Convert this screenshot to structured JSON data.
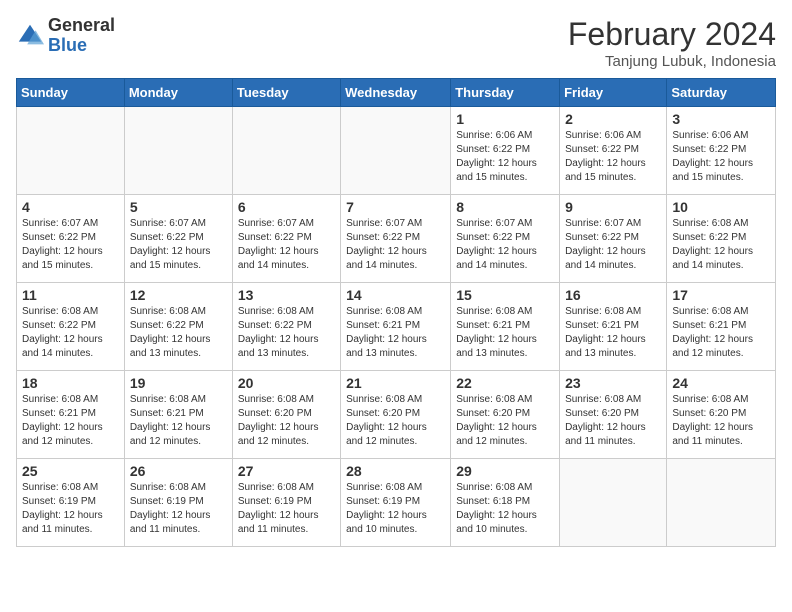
{
  "logo": {
    "general": "General",
    "blue": "Blue"
  },
  "title": {
    "month_year": "February 2024",
    "location": "Tanjung Lubuk, Indonesia"
  },
  "days_of_week": [
    "Sunday",
    "Monday",
    "Tuesday",
    "Wednesday",
    "Thursday",
    "Friday",
    "Saturday"
  ],
  "weeks": [
    [
      {
        "day": "",
        "info": ""
      },
      {
        "day": "",
        "info": ""
      },
      {
        "day": "",
        "info": ""
      },
      {
        "day": "",
        "info": ""
      },
      {
        "day": "1",
        "info": "Sunrise: 6:06 AM\nSunset: 6:22 PM\nDaylight: 12 hours and 15 minutes."
      },
      {
        "day": "2",
        "info": "Sunrise: 6:06 AM\nSunset: 6:22 PM\nDaylight: 12 hours and 15 minutes."
      },
      {
        "day": "3",
        "info": "Sunrise: 6:06 AM\nSunset: 6:22 PM\nDaylight: 12 hours and 15 minutes."
      }
    ],
    [
      {
        "day": "4",
        "info": "Sunrise: 6:07 AM\nSunset: 6:22 PM\nDaylight: 12 hours and 15 minutes."
      },
      {
        "day": "5",
        "info": "Sunrise: 6:07 AM\nSunset: 6:22 PM\nDaylight: 12 hours and 15 minutes."
      },
      {
        "day": "6",
        "info": "Sunrise: 6:07 AM\nSunset: 6:22 PM\nDaylight: 12 hours and 14 minutes."
      },
      {
        "day": "7",
        "info": "Sunrise: 6:07 AM\nSunset: 6:22 PM\nDaylight: 12 hours and 14 minutes."
      },
      {
        "day": "8",
        "info": "Sunrise: 6:07 AM\nSunset: 6:22 PM\nDaylight: 12 hours and 14 minutes."
      },
      {
        "day": "9",
        "info": "Sunrise: 6:07 AM\nSunset: 6:22 PM\nDaylight: 12 hours and 14 minutes."
      },
      {
        "day": "10",
        "info": "Sunrise: 6:08 AM\nSunset: 6:22 PM\nDaylight: 12 hours and 14 minutes."
      }
    ],
    [
      {
        "day": "11",
        "info": "Sunrise: 6:08 AM\nSunset: 6:22 PM\nDaylight: 12 hours and 14 minutes."
      },
      {
        "day": "12",
        "info": "Sunrise: 6:08 AM\nSunset: 6:22 PM\nDaylight: 12 hours and 13 minutes."
      },
      {
        "day": "13",
        "info": "Sunrise: 6:08 AM\nSunset: 6:22 PM\nDaylight: 12 hours and 13 minutes."
      },
      {
        "day": "14",
        "info": "Sunrise: 6:08 AM\nSunset: 6:21 PM\nDaylight: 12 hours and 13 minutes."
      },
      {
        "day": "15",
        "info": "Sunrise: 6:08 AM\nSunset: 6:21 PM\nDaylight: 12 hours and 13 minutes."
      },
      {
        "day": "16",
        "info": "Sunrise: 6:08 AM\nSunset: 6:21 PM\nDaylight: 12 hours and 13 minutes."
      },
      {
        "day": "17",
        "info": "Sunrise: 6:08 AM\nSunset: 6:21 PM\nDaylight: 12 hours and 12 minutes."
      }
    ],
    [
      {
        "day": "18",
        "info": "Sunrise: 6:08 AM\nSunset: 6:21 PM\nDaylight: 12 hours and 12 minutes."
      },
      {
        "day": "19",
        "info": "Sunrise: 6:08 AM\nSunset: 6:21 PM\nDaylight: 12 hours and 12 minutes."
      },
      {
        "day": "20",
        "info": "Sunrise: 6:08 AM\nSunset: 6:20 PM\nDaylight: 12 hours and 12 minutes."
      },
      {
        "day": "21",
        "info": "Sunrise: 6:08 AM\nSunset: 6:20 PM\nDaylight: 12 hours and 12 minutes."
      },
      {
        "day": "22",
        "info": "Sunrise: 6:08 AM\nSunset: 6:20 PM\nDaylight: 12 hours and 12 minutes."
      },
      {
        "day": "23",
        "info": "Sunrise: 6:08 AM\nSunset: 6:20 PM\nDaylight: 12 hours and 11 minutes."
      },
      {
        "day": "24",
        "info": "Sunrise: 6:08 AM\nSunset: 6:20 PM\nDaylight: 12 hours and 11 minutes."
      }
    ],
    [
      {
        "day": "25",
        "info": "Sunrise: 6:08 AM\nSunset: 6:19 PM\nDaylight: 12 hours and 11 minutes."
      },
      {
        "day": "26",
        "info": "Sunrise: 6:08 AM\nSunset: 6:19 PM\nDaylight: 12 hours and 11 minutes."
      },
      {
        "day": "27",
        "info": "Sunrise: 6:08 AM\nSunset: 6:19 PM\nDaylight: 12 hours and 11 minutes."
      },
      {
        "day": "28",
        "info": "Sunrise: 6:08 AM\nSunset: 6:19 PM\nDaylight: 12 hours and 10 minutes."
      },
      {
        "day": "29",
        "info": "Sunrise: 6:08 AM\nSunset: 6:18 PM\nDaylight: 12 hours and 10 minutes."
      },
      {
        "day": "",
        "info": ""
      },
      {
        "day": "",
        "info": ""
      }
    ]
  ]
}
